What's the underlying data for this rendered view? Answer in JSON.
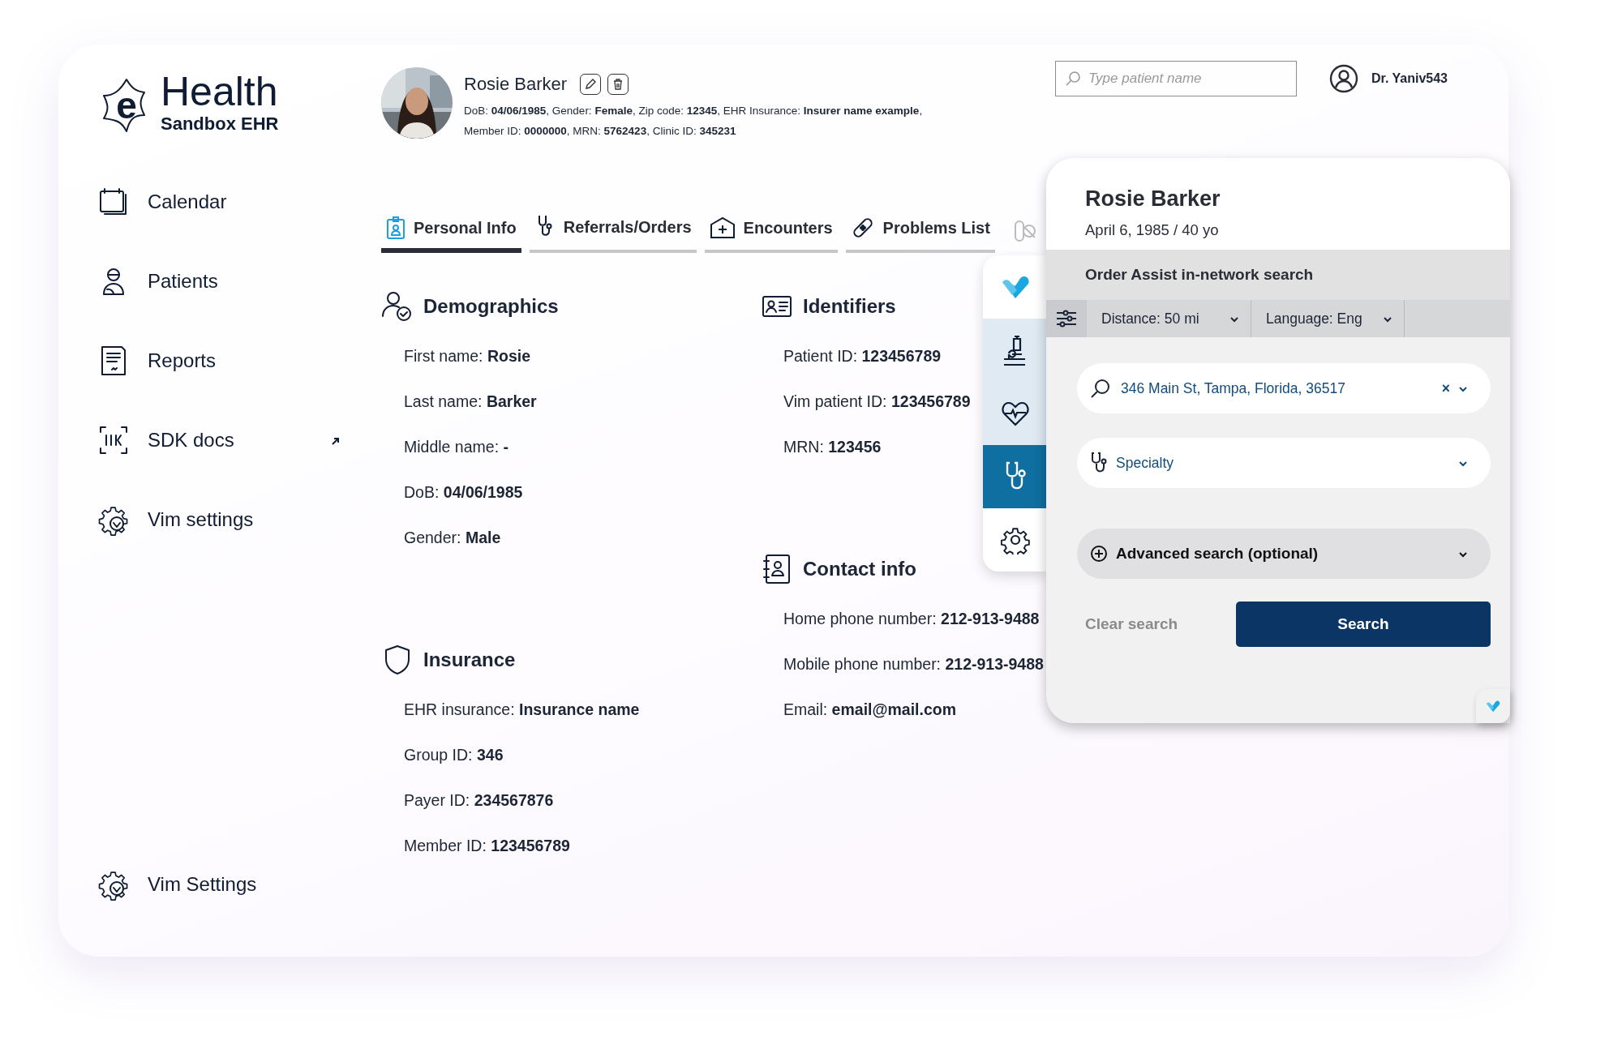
{
  "logo": {
    "badge": "e",
    "title": "Health",
    "subtitle": "Sandbox EHR"
  },
  "sidebar": {
    "items": [
      {
        "kind": "calendar",
        "label": "Calendar",
        "external": false
      },
      {
        "kind": "patients",
        "label": "Patients",
        "external": false
      },
      {
        "kind": "reports",
        "label": "Reports",
        "external": false
      },
      {
        "kind": "sdk",
        "label": "SDK docs",
        "external": true
      },
      {
        "kind": "settings",
        "label": "Vim settings",
        "external": false
      }
    ],
    "footer_item": {
      "kind": "settings",
      "label": "Vim Settings"
    }
  },
  "patient_header": {
    "name": "Rosie Barker",
    "details": [
      "DoB: **04/06/1985**, Gender: **Female**, Zip code: **12345**, EHR Insurance: **Insurer name example**,",
      "Member ID: **0000000**, MRN: **5762423**, Clinic ID: **345231**"
    ]
  },
  "patient_search": {
    "placeholder": "Type patient name"
  },
  "user": {
    "name": "Dr. Yaniv543"
  },
  "tabs": [
    {
      "kind": "personal",
      "label": "Personal Info",
      "selected": true
    },
    {
      "kind": "referrals",
      "label": "Referrals/Orders",
      "selected": false
    },
    {
      "kind": "encounters",
      "label": "Encounters",
      "selected": false
    },
    {
      "kind": "problems",
      "label": "Problems List",
      "selected": false
    }
  ],
  "columns": [
    [
      {
        "kind": "demographics",
        "title": "Demographics",
        "fields": [
          "First name: **Rosie**",
          "Last name: **Barker**",
          "Middle name: **-**",
          "DoB: **04/06/1985**",
          "Gender: **Male**"
        ]
      },
      {
        "kind": "insurance",
        "title": "Insurance",
        "fields": [
          "EHR insurance: **Insurance name**",
          "Group ID: **346**",
          "Payer ID: **234567876**",
          "Member ID: **123456789**"
        ]
      }
    ],
    [
      {
        "kind": "identifiers",
        "title": "Identifiers",
        "fields": [
          "Patient ID: **123456789**",
          "Vim patient ID: **123456789**",
          "MRN: **123456**"
        ]
      },
      {
        "kind": "contact",
        "title": "Contact info",
        "fields": [
          "Home phone number: **212-913-9488**",
          "Mobile phone number: **212-913-9488**",
          "Email: **email@mail.com**"
        ]
      }
    ]
  ],
  "vim_toolbar": {
    "items": [
      {
        "kind": "logo",
        "selected": false
      },
      {
        "kind": "lab",
        "selected": false
      },
      {
        "kind": "vitals",
        "selected": false
      },
      {
        "kind": "referral",
        "selected": true
      },
      {
        "kind": "settings",
        "selected": false
      }
    ]
  },
  "order_assist": {
    "patient_name": "Rosie Barker",
    "patient_age": "April 6, 1985 / 40 yo",
    "title": "Order Assist in-network search",
    "filters": [
      {
        "label": "Distance: 50 mi"
      },
      {
        "label": "Language: Eng"
      }
    ],
    "address": {
      "value": "346 Main St, Tampa, Florida, 36517",
      "clear": "×"
    },
    "specialty": {
      "label": "Specialty"
    },
    "advanced": {
      "label": "Advanced search (optional)"
    },
    "clear_label": "Clear search",
    "search_label": "Search"
  }
}
